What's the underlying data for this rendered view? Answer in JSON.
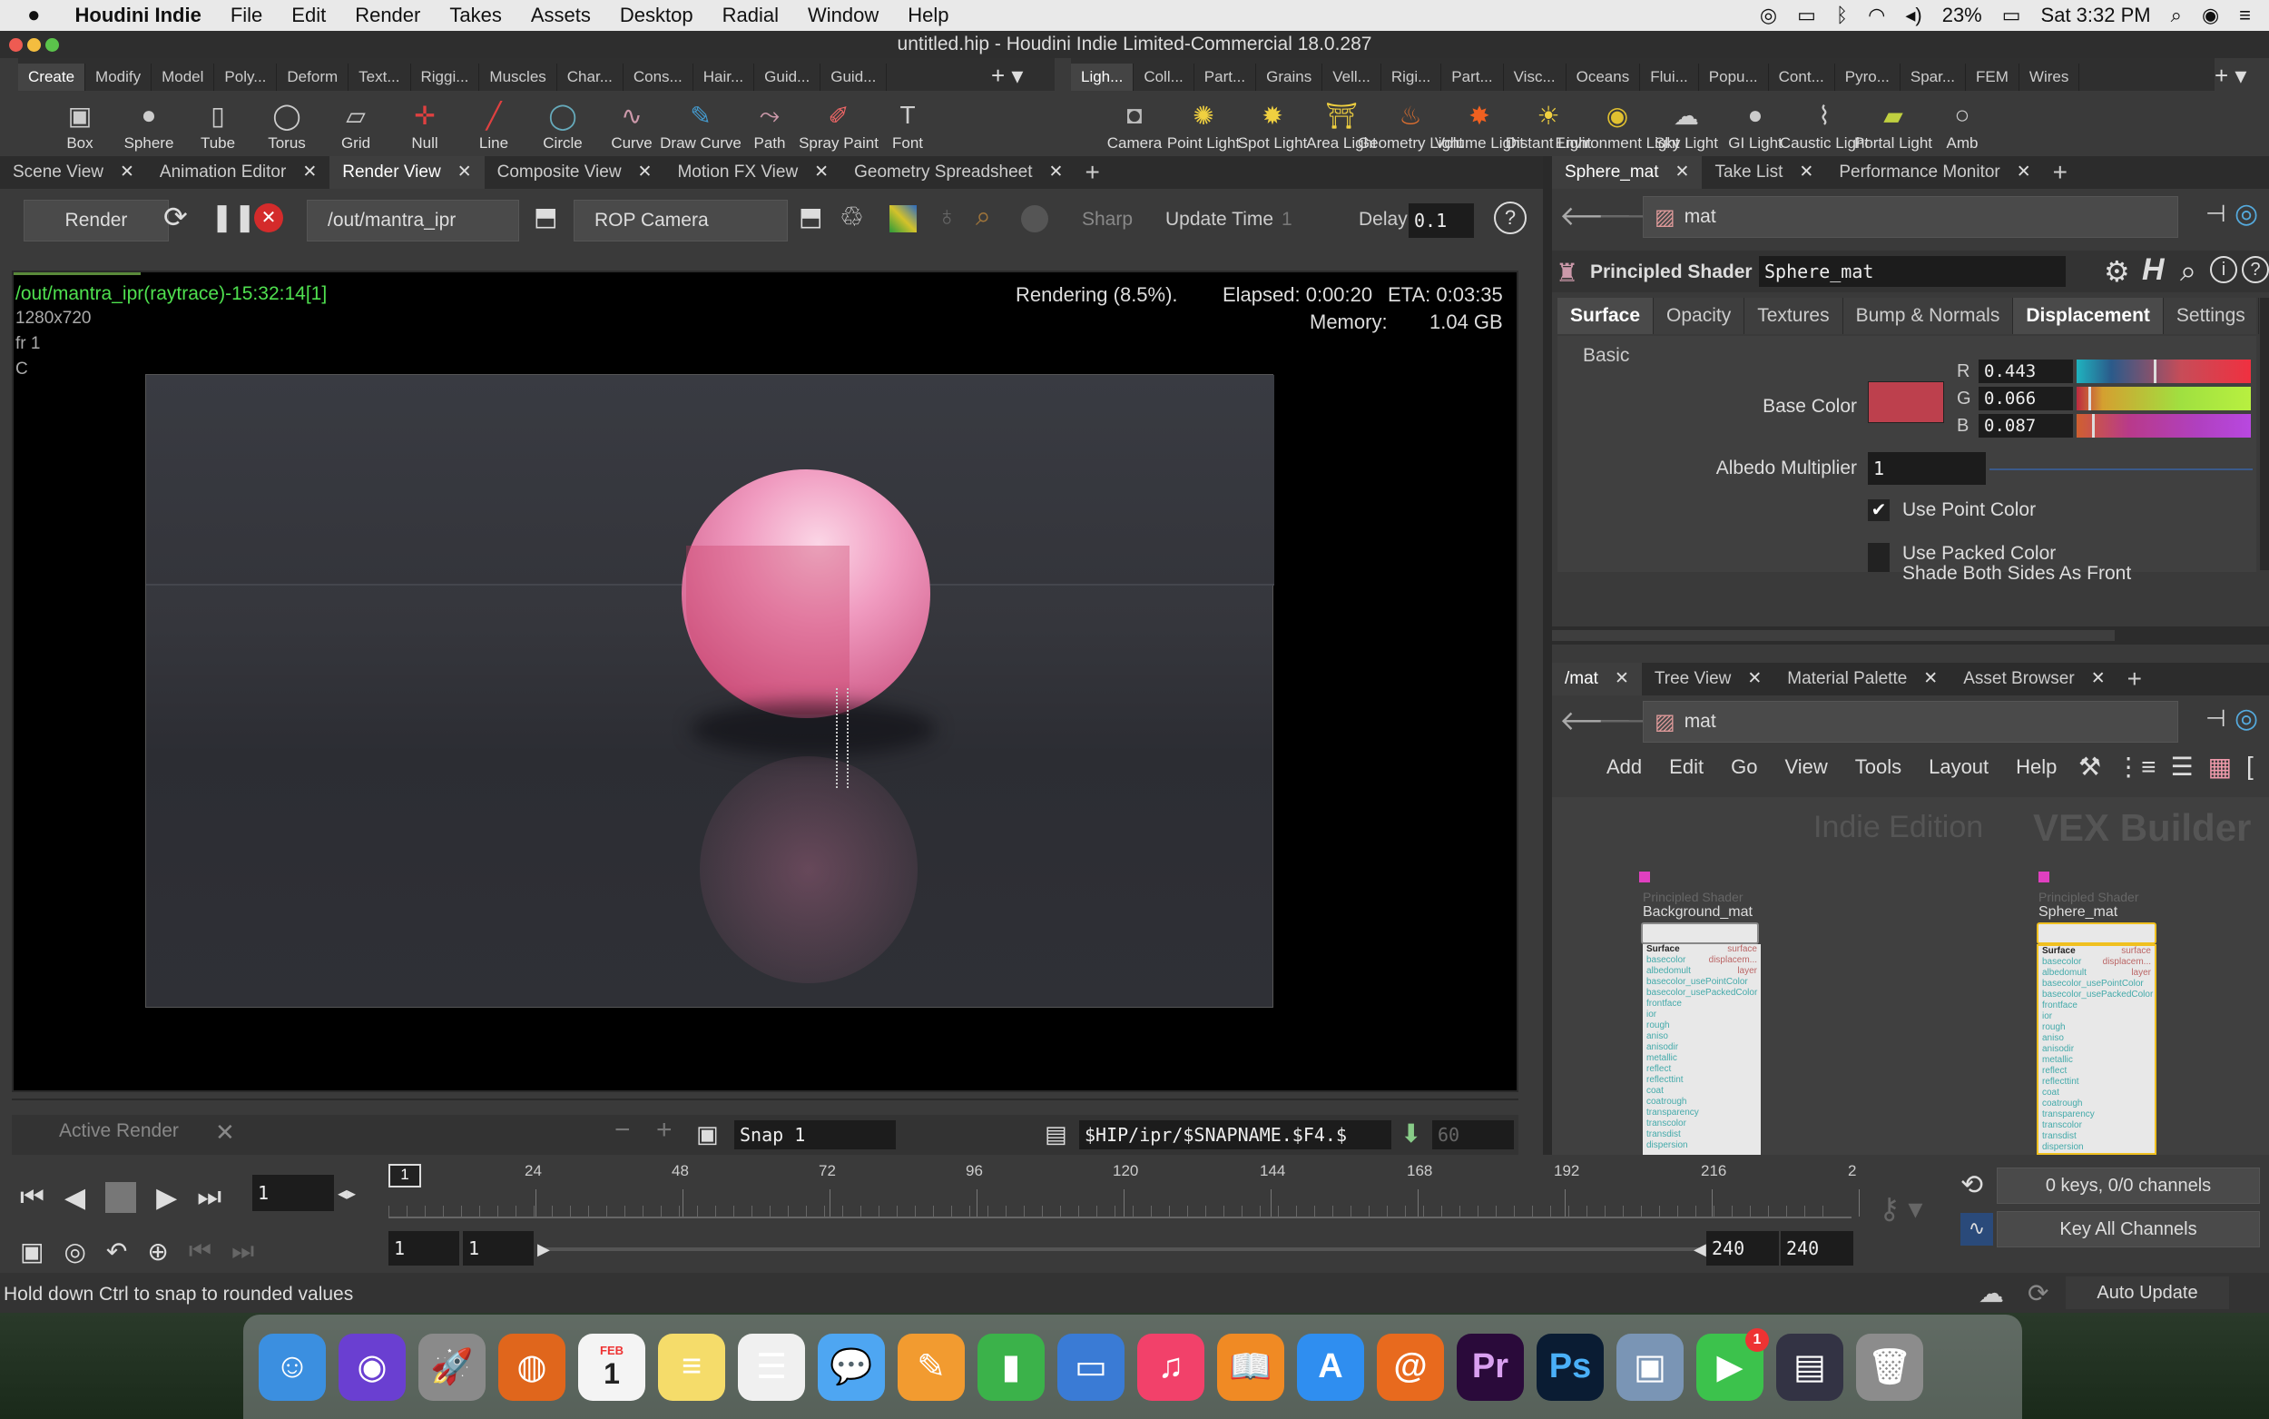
{
  "menubar": {
    "app": "Houdini Indie",
    "items": [
      "File",
      "Edit",
      "Render",
      "Takes",
      "Assets",
      "Desktop",
      "Radial",
      "Window",
      "Help"
    ],
    "battery": "23%",
    "clock": "Sat 3:32 PM"
  },
  "window_title": "untitled.hip - Houdini Indie Limited-Commercial 18.0.287",
  "shelf_left_tabs": [
    "Create",
    "Modify",
    "Model",
    "Poly...",
    "Deform",
    "Text...",
    "Riggi...",
    "Muscles",
    "Char...",
    "Cons...",
    "Hair...",
    "Guid...",
    "Guid..."
  ],
  "shelf_right_tabs": [
    "Ligh...",
    "Coll...",
    "Part...",
    "Grains",
    "Vell...",
    "Rigi...",
    "Part...",
    "Visc...",
    "Oceans",
    "Flui...",
    "Popu...",
    "Cont...",
    "Pyro...",
    "Spar...",
    "FEM",
    "Wires"
  ],
  "tools_left": [
    {
      "label": "Box",
      "icon": "box-icon"
    },
    {
      "label": "Sphere",
      "icon": "sphere-icon"
    },
    {
      "label": "Tube",
      "icon": "tube-icon"
    },
    {
      "label": "Torus",
      "icon": "torus-icon"
    },
    {
      "label": "Grid",
      "icon": "grid-icon"
    },
    {
      "label": "Null",
      "icon": "null-icon"
    },
    {
      "label": "Line",
      "icon": "line-icon"
    },
    {
      "label": "Circle",
      "icon": "circle-icon"
    },
    {
      "label": "Curve",
      "icon": "curve-icon"
    },
    {
      "label": "Draw Curve",
      "icon": "draw-curve-icon"
    },
    {
      "label": "Path",
      "icon": "path-icon"
    },
    {
      "label": "Spray Paint",
      "icon": "spray-paint-icon"
    },
    {
      "label": "Font",
      "icon": "font-icon"
    }
  ],
  "tools_right": [
    {
      "label": "Camera",
      "icon": "camera-icon"
    },
    {
      "label": "Point Light",
      "icon": "point-light-icon"
    },
    {
      "label": "Spot Light",
      "icon": "spot-light-icon"
    },
    {
      "label": "Area Light",
      "icon": "area-light-icon"
    },
    {
      "label": "Geometry Light",
      "icon": "geometry-light-icon"
    },
    {
      "label": "Volume Light",
      "icon": "volume-light-icon"
    },
    {
      "label": "Distant Light",
      "icon": "distant-light-icon"
    },
    {
      "label": "Environment Light",
      "icon": "environment-light-icon"
    },
    {
      "label": "Sky Light",
      "icon": "sky-light-icon"
    },
    {
      "label": "GI Light",
      "icon": "gi-light-icon"
    },
    {
      "label": "Caustic Light",
      "icon": "caustic-light-icon"
    },
    {
      "label": "Portal Light",
      "icon": "portal-light-icon"
    },
    {
      "label": "Amb",
      "icon": "ambient-light-icon"
    }
  ],
  "left_panes": [
    "Scene View",
    "Animation Editor",
    "Render View",
    "Composite View",
    "Motion FX View",
    "Geometry Spreadsheet"
  ],
  "render_toolbar": {
    "render_label": "Render",
    "rop": "/out/mantra_ipr",
    "camera": "ROP Camera",
    "sharp": "Sharp",
    "update_time_label": "Update Time",
    "update_time_value": "1",
    "delay_label": "Delay",
    "delay_value": "0.1"
  },
  "viewport": {
    "path": "/out/mantra_ipr(raytrace)-15:32:14[1]",
    "resolution": "1280x720",
    "frame": "fr 1",
    "channel": "C",
    "status": "Rendering (8.5%).",
    "elapsed": "Elapsed: 0:00:20",
    "eta": "ETA: 0:03:35",
    "memory_label": "Memory:",
    "memory_value": "1.04 GB"
  },
  "render_footer": {
    "active_render": "Active Render",
    "snap": "Snap 1",
    "output_path": "$HIP/ipr/$SNAPNAME.$F4.$",
    "frame_value": "60"
  },
  "right_top_tabs": [
    "Sphere_mat",
    "Take List",
    "Performance Monitor"
  ],
  "net_path": "mat",
  "shader": {
    "type": "Principled Shader",
    "name": "Sphere_mat",
    "tabs": [
      "Surface",
      "Opacity",
      "Textures",
      "Bump & Normals",
      "Displacement",
      "Settings"
    ],
    "section": "Basic",
    "base_color_label": "Base Color",
    "r": "0.443",
    "g": "0.066",
    "b": "0.087",
    "albedo_label": "Albedo Multiplier",
    "albedo_value": "1",
    "use_point_color": "Use Point Color",
    "use_packed_color": "Use Packed Color",
    "shade_both": "Shade Both Sides As Front",
    "color_hex": "#bd404d"
  },
  "right_bottom_tabs": [
    "/mat",
    "Tree View",
    "Material Palette",
    "Asset Browser"
  ],
  "network_menu": [
    "Add",
    "Edit",
    "Go",
    "View",
    "Tools",
    "Layout",
    "Help"
  ],
  "network": {
    "watermark1": "Indie Edition",
    "watermark2": "VEX Builder",
    "node1_type": "Principled Shader",
    "node1_name": "Background_mat",
    "node2_type": "Principled Shader",
    "node2_name": "Sphere_mat",
    "node_header": "Surface",
    "node_out1": "surface",
    "node_out2": "displacem...",
    "node_out3": "layer",
    "ports": [
      "basecolor",
      "albedomult",
      "basecolor_usePointColor",
      "basecolor_usePackedColor",
      "frontface",
      "ior",
      "rough",
      "aniso",
      "anisodir",
      "metallic",
      "reflect",
      "reflecttint",
      "coat",
      "coatrough",
      "transparency",
      "transcolor",
      "transdist",
      "dispersion"
    ]
  },
  "timeline": {
    "current_frame": "1",
    "ticks": [
      "24",
      "48",
      "72",
      "96",
      "120",
      "144",
      "168",
      "192",
      "216",
      "2"
    ],
    "marker": "1",
    "range_start": "1",
    "range_start2": "1",
    "range_end": "240",
    "range_end2": "240",
    "keys": "0 keys, 0/0 channels",
    "key_all": "Key All Channels",
    "auto_update": "Auto Update"
  },
  "status_message": "Hold down Ctrl to snap to rounded values",
  "dock": [
    {
      "name": "finder",
      "color": "#3b8fe0",
      "glyph": "☺"
    },
    {
      "name": "siri",
      "color": "#6a3fd1",
      "glyph": "◉"
    },
    {
      "name": "launchpad",
      "color": "#8a8a8a",
      "glyph": "🚀"
    },
    {
      "name": "firefox",
      "color": "#e0661c",
      "glyph": "◍"
    },
    {
      "name": "calendar",
      "color": "#f4f4f4",
      "glyph": "1"
    },
    {
      "name": "notes",
      "color": "#f5dc6a",
      "glyph": "≡"
    },
    {
      "name": "reminders",
      "color": "#f0f0f0",
      "glyph": "☰"
    },
    {
      "name": "messages",
      "color": "#4ea6f2",
      "glyph": "💬"
    },
    {
      "name": "pages",
      "color": "#f29b30",
      "glyph": "✎"
    },
    {
      "name": "numbers",
      "color": "#3bb24a",
      "glyph": "▮"
    },
    {
      "name": "keynote",
      "color": "#3a7bd5",
      "glyph": "▭"
    },
    {
      "name": "music",
      "color": "#f2416a",
      "glyph": "♫"
    },
    {
      "name": "books",
      "color": "#f08a24",
      "glyph": "📖"
    },
    {
      "name": "app-store",
      "color": "#2f8ef0",
      "glyph": "A"
    },
    {
      "name": "houdini",
      "color": "#e86a1e",
      "glyph": "@"
    },
    {
      "name": "premiere",
      "color": "#2a0a3a",
      "glyph": "Pr"
    },
    {
      "name": "photoshop",
      "color": "#0a1c33",
      "glyph": "Ps"
    },
    {
      "name": "preview",
      "color": "#7a95b5",
      "glyph": "▣"
    },
    {
      "name": "facetime",
      "color": "#3cc24c",
      "glyph": "▶"
    },
    {
      "name": "screenshot",
      "color": "#334",
      "glyph": "▤"
    },
    {
      "name": "trash",
      "color": "#8c8c8c",
      "glyph": "🗑"
    }
  ],
  "calendar_month": "FEB",
  "facetime_badge": "1"
}
